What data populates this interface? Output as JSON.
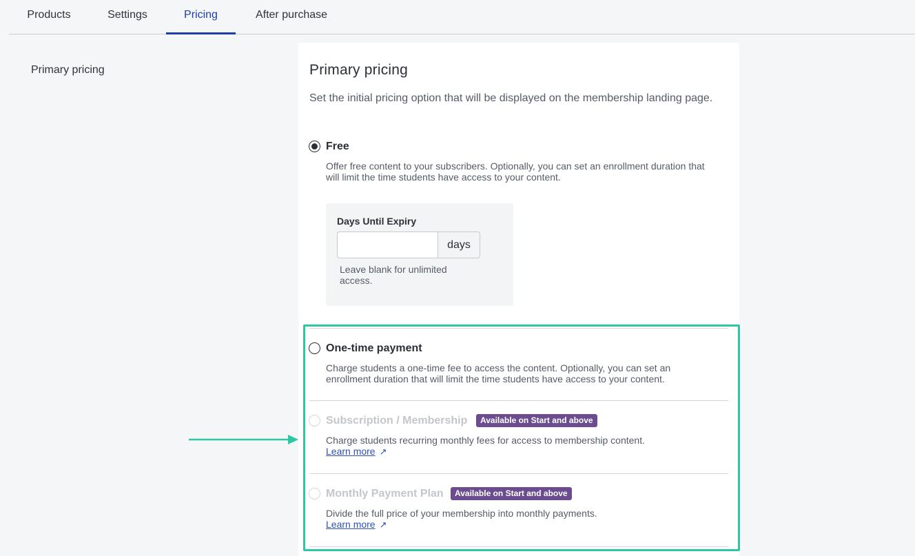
{
  "tabs": [
    {
      "label": "Products"
    },
    {
      "label": "Settings"
    },
    {
      "label": "Pricing"
    },
    {
      "label": "After purchase"
    }
  ],
  "active_tab": "Pricing",
  "sidebar": {
    "section_label": "Primary pricing"
  },
  "card": {
    "title": "Primary pricing",
    "description": "Set the initial pricing option that will be displayed on the membership landing page."
  },
  "options": {
    "free": {
      "title": "Free",
      "selected": true,
      "description": "Offer free content to your subscribers. Optionally, you can set an enrollment duration that will limit the time students have access to your content.",
      "expiry": {
        "label": "Days Until Expiry",
        "value": "",
        "unit": "days",
        "help": "Leave blank for unlimited access."
      }
    },
    "one_time": {
      "title": "One-time payment",
      "selected": false,
      "description": "Charge students a one-time fee to access the content. Optionally, you can set an enrollment duration that will limit the time students have access to your content."
    },
    "subscription": {
      "title": "Subscription / Membership",
      "disabled": true,
      "badge": "Available on Start and above",
      "description": "Charge students recurring monthly fees for access to membership content.",
      "link": "Learn more"
    },
    "payment_plan": {
      "title": "Monthly Payment Plan",
      "disabled": true,
      "badge": "Available on Start and above",
      "description": "Divide the full price of your membership into monthly payments.",
      "link": "Learn more"
    }
  },
  "colors": {
    "accent": "#1b3ea8",
    "badge": "#6b4c8f",
    "highlight": "#2dc7a3",
    "link": "#2e4fb8"
  }
}
